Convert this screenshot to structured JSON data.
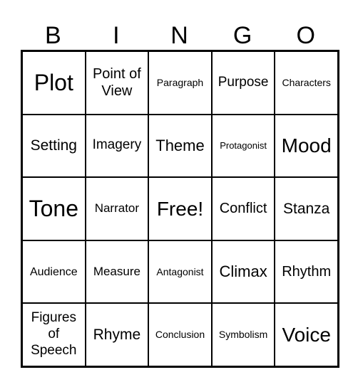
{
  "header": [
    "B",
    "I",
    "N",
    "G",
    "O"
  ],
  "cells": [
    {
      "t": "Plot",
      "s": 32
    },
    {
      "t": "Point of View",
      "s": 20
    },
    {
      "t": "Paragraph",
      "s": 14
    },
    {
      "t": "Purpose",
      "s": 19
    },
    {
      "t": "Characters",
      "s": 14
    },
    {
      "t": "Setting",
      "s": 21
    },
    {
      "t": "Imagery",
      "s": 19
    },
    {
      "t": "Theme",
      "s": 22
    },
    {
      "t": "Protagonist",
      "s": 13
    },
    {
      "t": "Mood",
      "s": 28
    },
    {
      "t": "Tone",
      "s": 32
    },
    {
      "t": "Narrator",
      "s": 17
    },
    {
      "t": "Free!",
      "s": 28
    },
    {
      "t": "Conflict",
      "s": 20
    },
    {
      "t": "Stanza",
      "s": 21
    },
    {
      "t": "Audience",
      "s": 16
    },
    {
      "t": "Measure",
      "s": 17
    },
    {
      "t": "Antagonist",
      "s": 14
    },
    {
      "t": "Climax",
      "s": 22
    },
    {
      "t": "Rhythm",
      "s": 20
    },
    {
      "t": "Figures of Speech",
      "s": 19
    },
    {
      "t": "Rhyme",
      "s": 21
    },
    {
      "t": "Conclusion",
      "s": 14
    },
    {
      "t": "Symbolism",
      "s": 14
    },
    {
      "t": "Voice",
      "s": 28
    }
  ]
}
